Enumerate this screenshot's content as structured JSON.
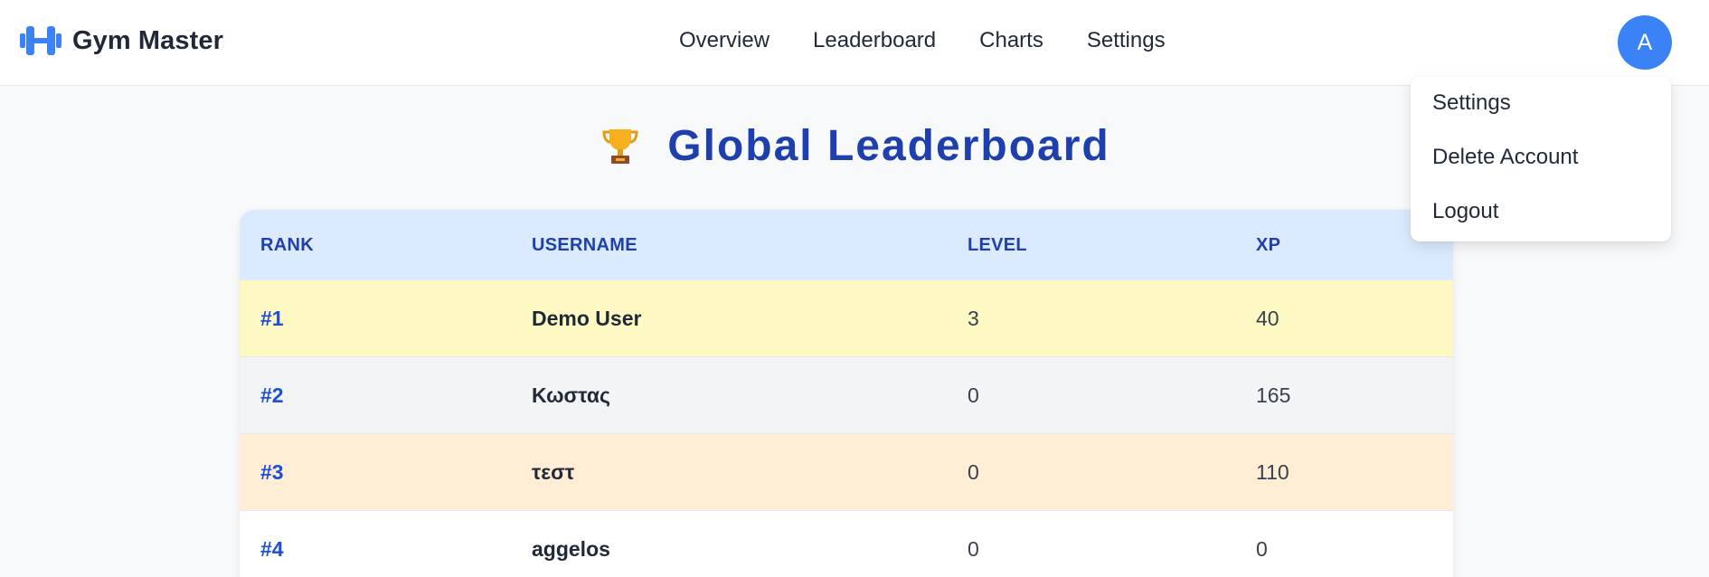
{
  "header": {
    "brand": "Gym Master",
    "brand_icon": "dumbbell-icon",
    "nav": [
      "Overview",
      "Leaderboard",
      "Charts",
      "Settings"
    ],
    "avatar_initial": "A"
  },
  "user_menu": {
    "items": [
      "Settings",
      "Delete Account",
      "Logout"
    ]
  },
  "page": {
    "title_icon": "trophy-icon",
    "title": "Global Leaderboard"
  },
  "leaderboard": {
    "columns": [
      "RANK",
      "USERNAME",
      "LEVEL",
      "XP"
    ],
    "rows": [
      {
        "rank": "#1",
        "username": "Demo User",
        "level": "3",
        "xp": "40"
      },
      {
        "rank": "#2",
        "username": "Κωστας",
        "level": "0",
        "xp": "165"
      },
      {
        "rank": "#3",
        "username": "τεστ",
        "level": "0",
        "xp": "110"
      },
      {
        "rank": "#4",
        "username": "aggelos",
        "level": "0",
        "xp": "0"
      }
    ]
  },
  "colors": {
    "accent": "#3b82f6",
    "title": "#1e40af",
    "header_row": "#dbeafe",
    "first_place": "#fef9c3",
    "second_place": "#f3f4f6",
    "third_place": "#ffedd5"
  }
}
